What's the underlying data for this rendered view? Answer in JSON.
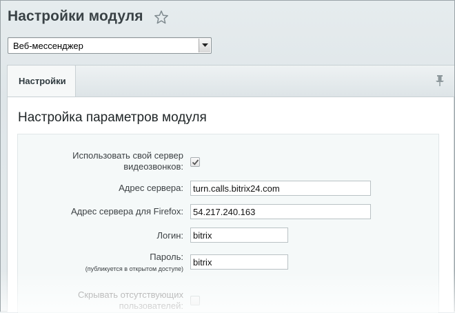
{
  "header": {
    "title": "Настройки модуля"
  },
  "module_select": {
    "value": "Веб-мессенджер"
  },
  "tabs": [
    {
      "label": "Настройки"
    }
  ],
  "section": {
    "title": "Настройка параметров модуля"
  },
  "form": {
    "custom_server": {
      "label_line1": "Использовать свой сервер",
      "label_line2": "видеозвонков:",
      "checked": true
    },
    "server_address": {
      "label": "Адрес сервера:",
      "value": "turn.calls.bitrix24.com"
    },
    "firefox_server": {
      "label": "Адрес сервера для Firefox:",
      "value": "54.217.240.163"
    },
    "login": {
      "label": "Логин:",
      "value": "bitrix"
    },
    "password": {
      "label": "Пароль:",
      "note": "(публикуется в открытом доступе)",
      "value": "bitrix"
    },
    "hide_absent": {
      "label_line1": "Скрывать отсутствующих",
      "label_line2": "пользователей:",
      "checked": false
    }
  }
}
